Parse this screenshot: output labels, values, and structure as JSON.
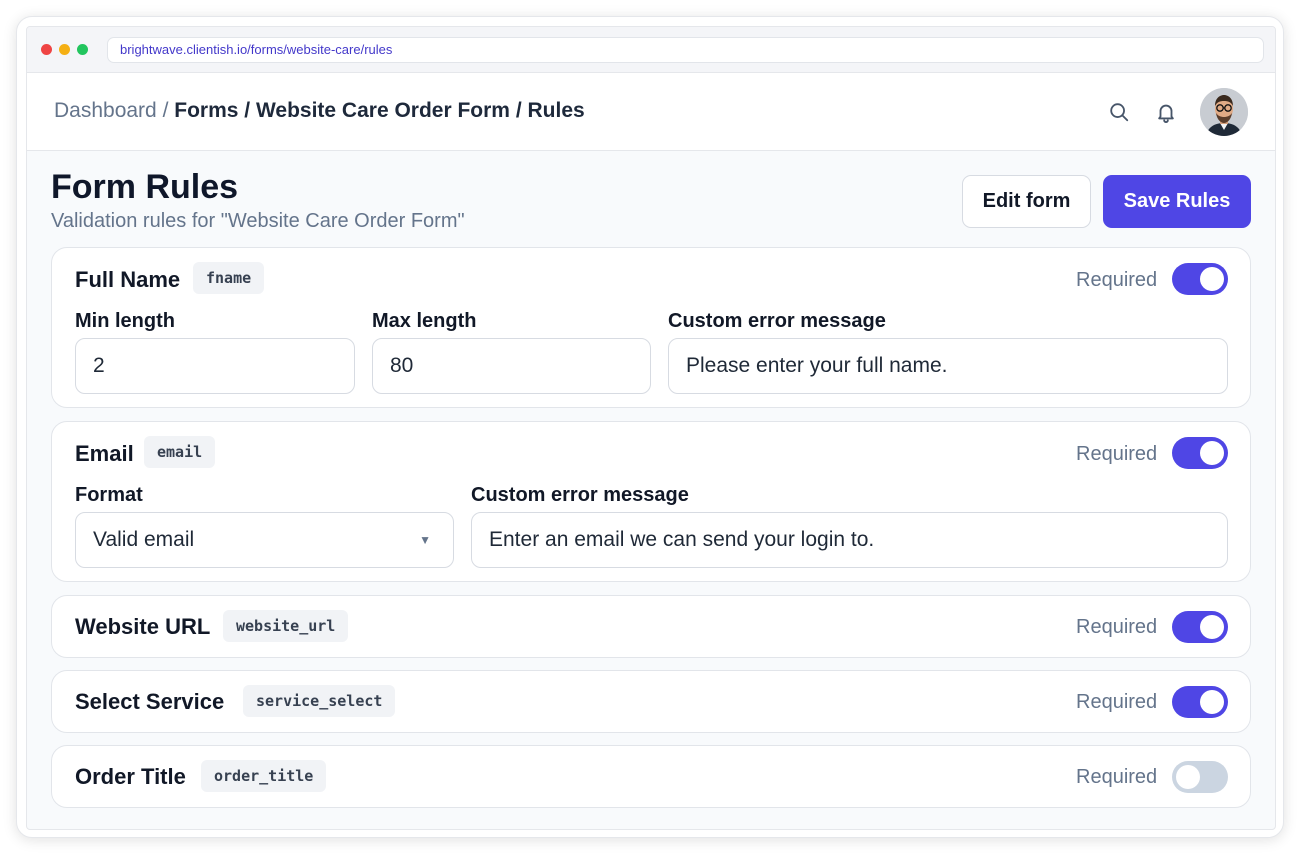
{
  "browser": {
    "url": "brightwave.clientish.io/forms/website-care/rules"
  },
  "breadcrumb": {
    "root": "Dashboard",
    "sep": " / ",
    "forms": "Forms",
    "form": "Website Care Order Form",
    "current": "Rules"
  },
  "header_icons": {
    "search": "search-icon",
    "bell": "bell-icon",
    "avatar": "user-avatar"
  },
  "page": {
    "title": "Form Rules",
    "subtitle": "Validation rules for \"Website Care Order Form\"",
    "edit_label": "Edit form",
    "save_label": "Save Rules"
  },
  "colors": {
    "accent": "#4f46e5",
    "toggle_off": "#cbd5e1"
  },
  "fields": [
    {
      "name": "Full Name",
      "key": "fname",
      "required_label": "Required",
      "required": true,
      "min_label": "Min length",
      "min_value": "2",
      "max_label": "Max length",
      "max_value": "80",
      "error_label": "Custom error message",
      "error_value": "Please enter your full name."
    },
    {
      "name": "Email",
      "key": "email",
      "required_label": "Required",
      "required": true,
      "format_label": "Format",
      "format_value": "Valid email",
      "error_label": "Custom error message",
      "error_value": "Enter an email we can send your login to."
    },
    {
      "name": "Website URL",
      "key": "website_url",
      "required_label": "Required",
      "required": true
    },
    {
      "name": "Select Service",
      "key": "service_select",
      "required_label": "Required",
      "required": true
    },
    {
      "name": "Order Title",
      "key": "order_title",
      "required_label": "Required",
      "required": false
    }
  ]
}
